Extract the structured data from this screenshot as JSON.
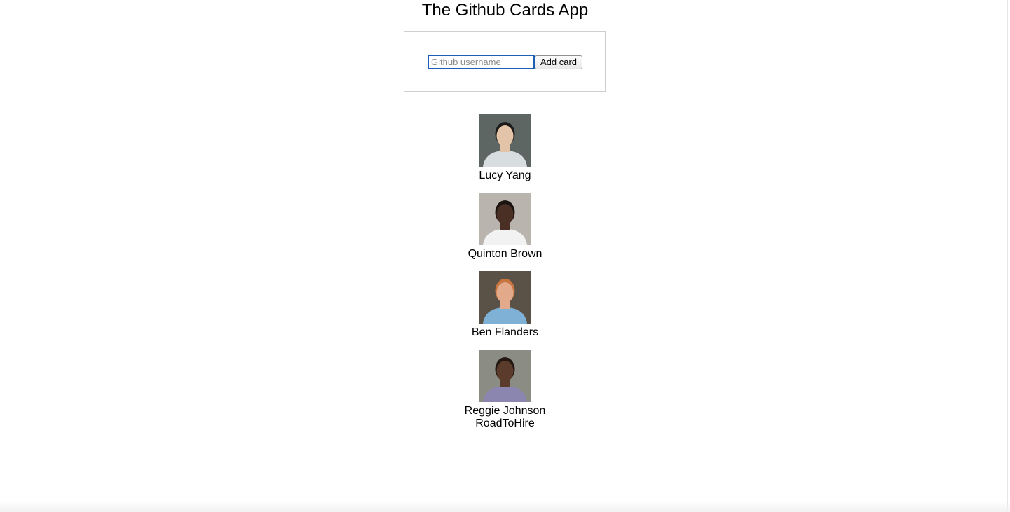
{
  "header": {
    "title": "The Github Cards App"
  },
  "form": {
    "placeholder": "Github username",
    "value": "",
    "add_label": "Add card"
  },
  "cards": [
    {
      "name": "Lucy Yang",
      "bg": "#5d6663",
      "skin": "#e3c4a8",
      "hair": "#1c1a1a",
      "shirt": "#d8dde0"
    },
    {
      "name": "Quinton Brown",
      "bg": "#b9b4ad",
      "skin": "#4a2f24",
      "hair": "#1b1310",
      "shirt": "#f2f2f2"
    },
    {
      "name": "Ben Flanders",
      "bg": "#5b5247",
      "skin": "#e2a98a",
      "hair": "#c8753f",
      "shirt": "#7fb0d6"
    },
    {
      "name": "Reggie Johnson RoadToHire",
      "bg": "#8b8c84",
      "skin": "#5b3b2c",
      "hair": "#231812",
      "shirt": "#8b86b0"
    }
  ]
}
